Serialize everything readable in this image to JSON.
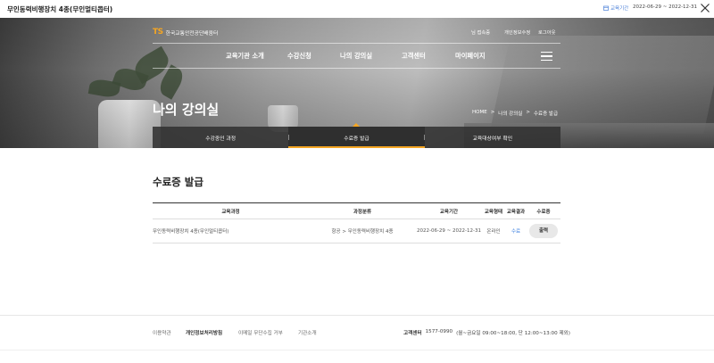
{
  "window": {
    "title": "무인동력비행장치 4종(무인멀티콥터)",
    "period_label": "교육기간",
    "period_value": "2022-06-29 ~ 2022-12-31"
  },
  "header": {
    "logo_mark": "TS",
    "logo_name": "한국교통안전공단배움터",
    "util_links": [
      "님 접속중",
      "개인정보수정",
      "로그아웃"
    ],
    "nav": [
      "교육기관 소개",
      "수강신청",
      "나의 강의실",
      "고객센터",
      "마이페이지"
    ]
  },
  "hero": {
    "title": "나의 강의실",
    "breadcrumb": [
      "HOME",
      ">",
      "나의 강의실",
      ">",
      "수료증 발급"
    ]
  },
  "tabs": [
    "수강중인 과정",
    "수료증 발급",
    "교육대상여부 확인"
  ],
  "main": {
    "title": "수료증 발급",
    "columns": [
      "교육과정",
      "과정분류",
      "교육기간",
      "교육형태",
      "교육결과",
      "수료증"
    ],
    "rows": [
      {
        "course": "무인동력비행장치 4종(무인멀티콥터)",
        "category": "항공 > 무인동력비행장치 4종",
        "period": "2022-06-29 ~ 2022-12-31",
        "type": "온라인",
        "result": "수료",
        "action": "출력"
      }
    ]
  },
  "footer": {
    "links": [
      "이용약관",
      "개인정보처리방침",
      "이메일 무단수집 거부",
      "기관소개"
    ],
    "cc_label": "고객센터",
    "cc_phone": "1577-0990",
    "cc_hours": "(월~금요일 09:00~18:00, 단 12:00~13:00 제외)"
  },
  "colors": {
    "accent": "#f5a623",
    "link_blue": "#3b7fe0"
  }
}
